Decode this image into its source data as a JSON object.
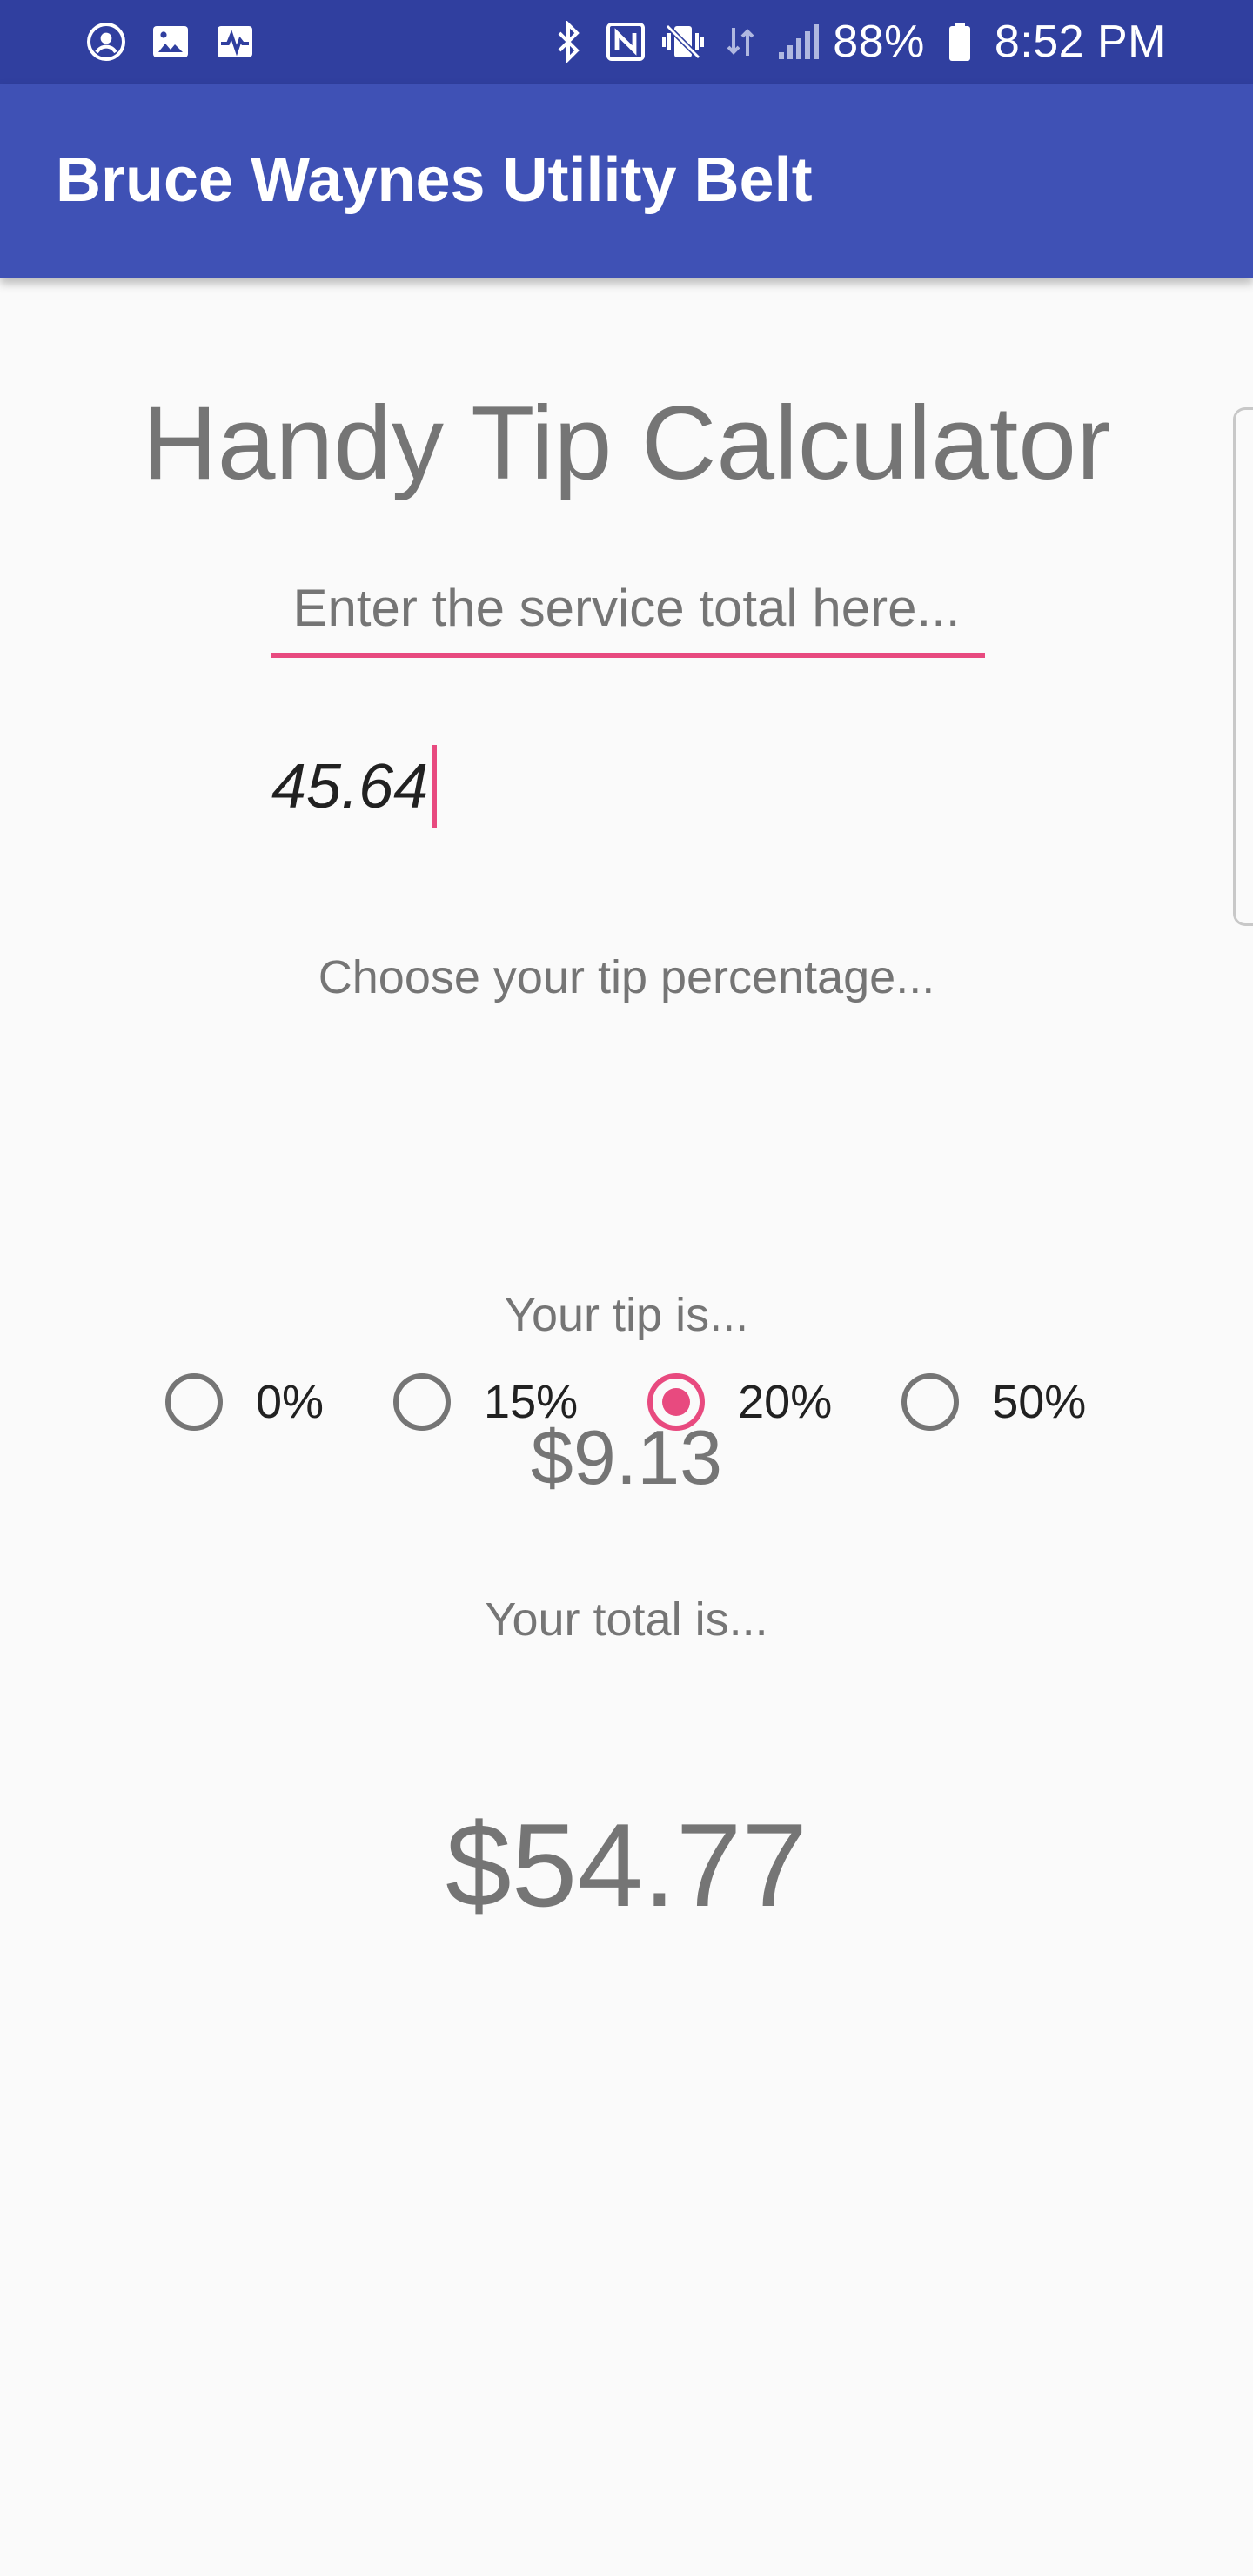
{
  "status_bar": {
    "icons_left": [
      "account-circle-icon",
      "image-icon",
      "activity-icon"
    ],
    "icons_right": [
      "bluetooth-icon",
      "nfc-icon",
      "vibrate-icon",
      "data-icon",
      "signal-icon"
    ],
    "battery": "88%",
    "time": "8:52 PM"
  },
  "app_bar": {
    "title": "Bruce Waynes Utility Belt",
    "color": "#3f51b5"
  },
  "main": {
    "heading": "Handy Tip Calculator",
    "service_prompt": "Enter the service total here...",
    "amount_value": "45.64",
    "tip_prompt": "Choose your tip percentage...",
    "tip_options": [
      {
        "label": "0%",
        "selected": false
      },
      {
        "label": "15%",
        "selected": false
      },
      {
        "label": "20%",
        "selected": true
      },
      {
        "label": "50%",
        "selected": false
      }
    ],
    "tip_label": "Your tip is...",
    "tip_value": "$9.13",
    "total_label": "Your total is...",
    "total_value": "$54.77"
  },
  "colors": {
    "primary_dark": "#303f9f",
    "primary": "#3f51b5",
    "accent": "#e84a7f",
    "text_secondary": "#757575"
  }
}
